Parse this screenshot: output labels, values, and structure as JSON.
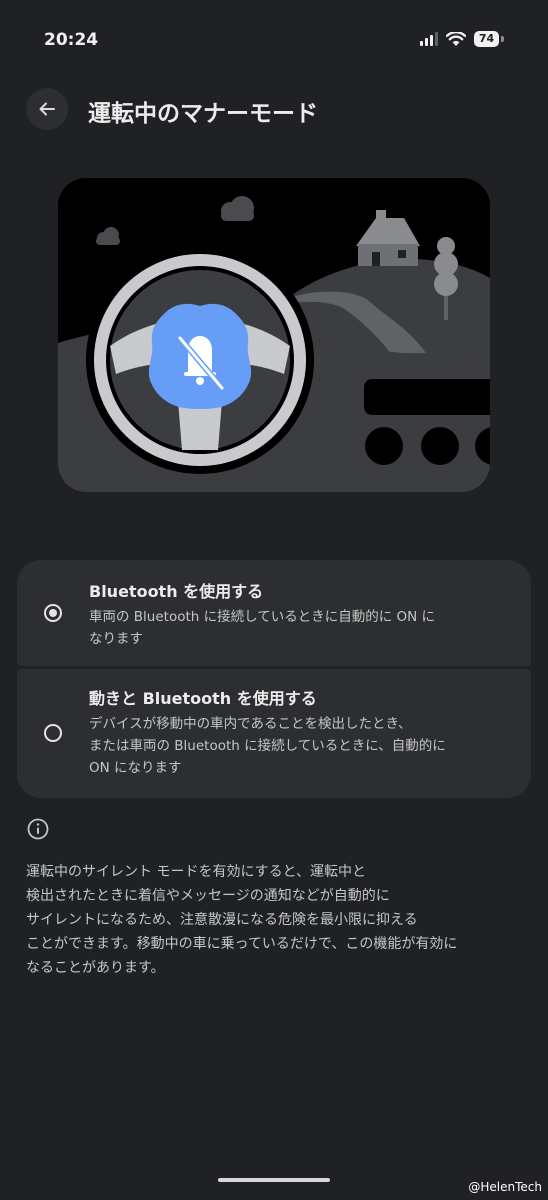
{
  "status_bar": {
    "time": "20:24",
    "battery_level": "74",
    "icons": [
      "signal-icon",
      "wifi-icon",
      "battery-icon"
    ]
  },
  "header": {
    "back_icon": "arrow-back-icon",
    "title": "運転中のマナーモード"
  },
  "illustration": {
    "icon": "bell-off-icon",
    "accent_color": "#669DF6"
  },
  "options": [
    {
      "title": "Bluetooth を使用する",
      "description_lines": [
        "車両の Bluetooth に接続しているときに自動的に ON に",
        "なります"
      ],
      "selected": true
    },
    {
      "title": "動きと Bluetooth を使用する",
      "description_lines": [
        "デバイスが移動中の車内であることを検出したとき、",
        "または車両の Bluetooth に接続しているときに、自動的に",
        "ON になります"
      ],
      "selected": false
    }
  ],
  "info": {
    "icon": "info-icon",
    "lines": [
      "運転中のサイレント モードを有効にすると、運転中と",
      "検出されたときに着信やメッセージの通知などが自動的に",
      "サイレントになるため、注意散漫になる危険を最小限に抑える",
      "ことができます。移動中の車に乗っているだけで、この機能が有効に",
      "なることがあります。"
    ]
  },
  "watermark": "@HelenTech"
}
